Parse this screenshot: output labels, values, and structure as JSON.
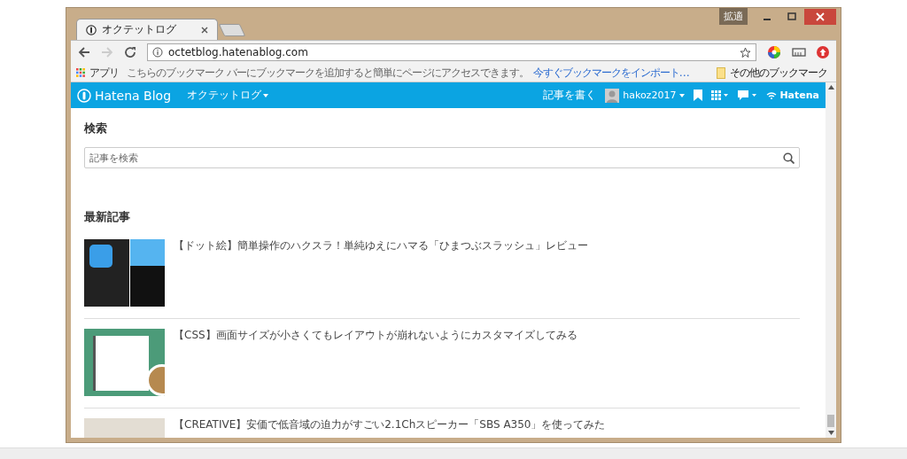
{
  "window": {
    "badge": "拡適"
  },
  "tabs": [
    {
      "title": "オクテットログ",
      "selected": true
    }
  ],
  "toolbar": {
    "url": "octetblog.hatenablog.com"
  },
  "bookmarks_bar": {
    "apps": "アプリ",
    "hint": "こちらのブックマーク バーにブックマークを追加すると簡単にページにアクセスできます。",
    "import_link": "今すぐブックマークをインポート…",
    "other": "その他のブックマーク"
  },
  "blog_header": {
    "logo": "Hatena Blog",
    "blog_name": "オクテットログ",
    "write": "記事を書く",
    "user": "hakoz2017",
    "brand": "Hatena"
  },
  "search": {
    "heading": "検索",
    "placeholder": "記事を検索"
  },
  "recent": {
    "heading": "最新記事",
    "entries": [
      {
        "title": "【ドット絵】簡単操作のハクスラ！単純ゆえにハマる「ひまつぶスラッシュ」レビュー",
        "kind": "game"
      },
      {
        "title": "【CSS】画面サイズが小さくてもレイアウトが崩れないようにカスタマイズしてみる",
        "kind": "notebook"
      },
      {
        "title": "【CREATIVE】安価で低音域の迫力がすごい2.1Chスピーカー「SBS A350」を使ってみた",
        "kind": "photo"
      }
    ]
  }
}
